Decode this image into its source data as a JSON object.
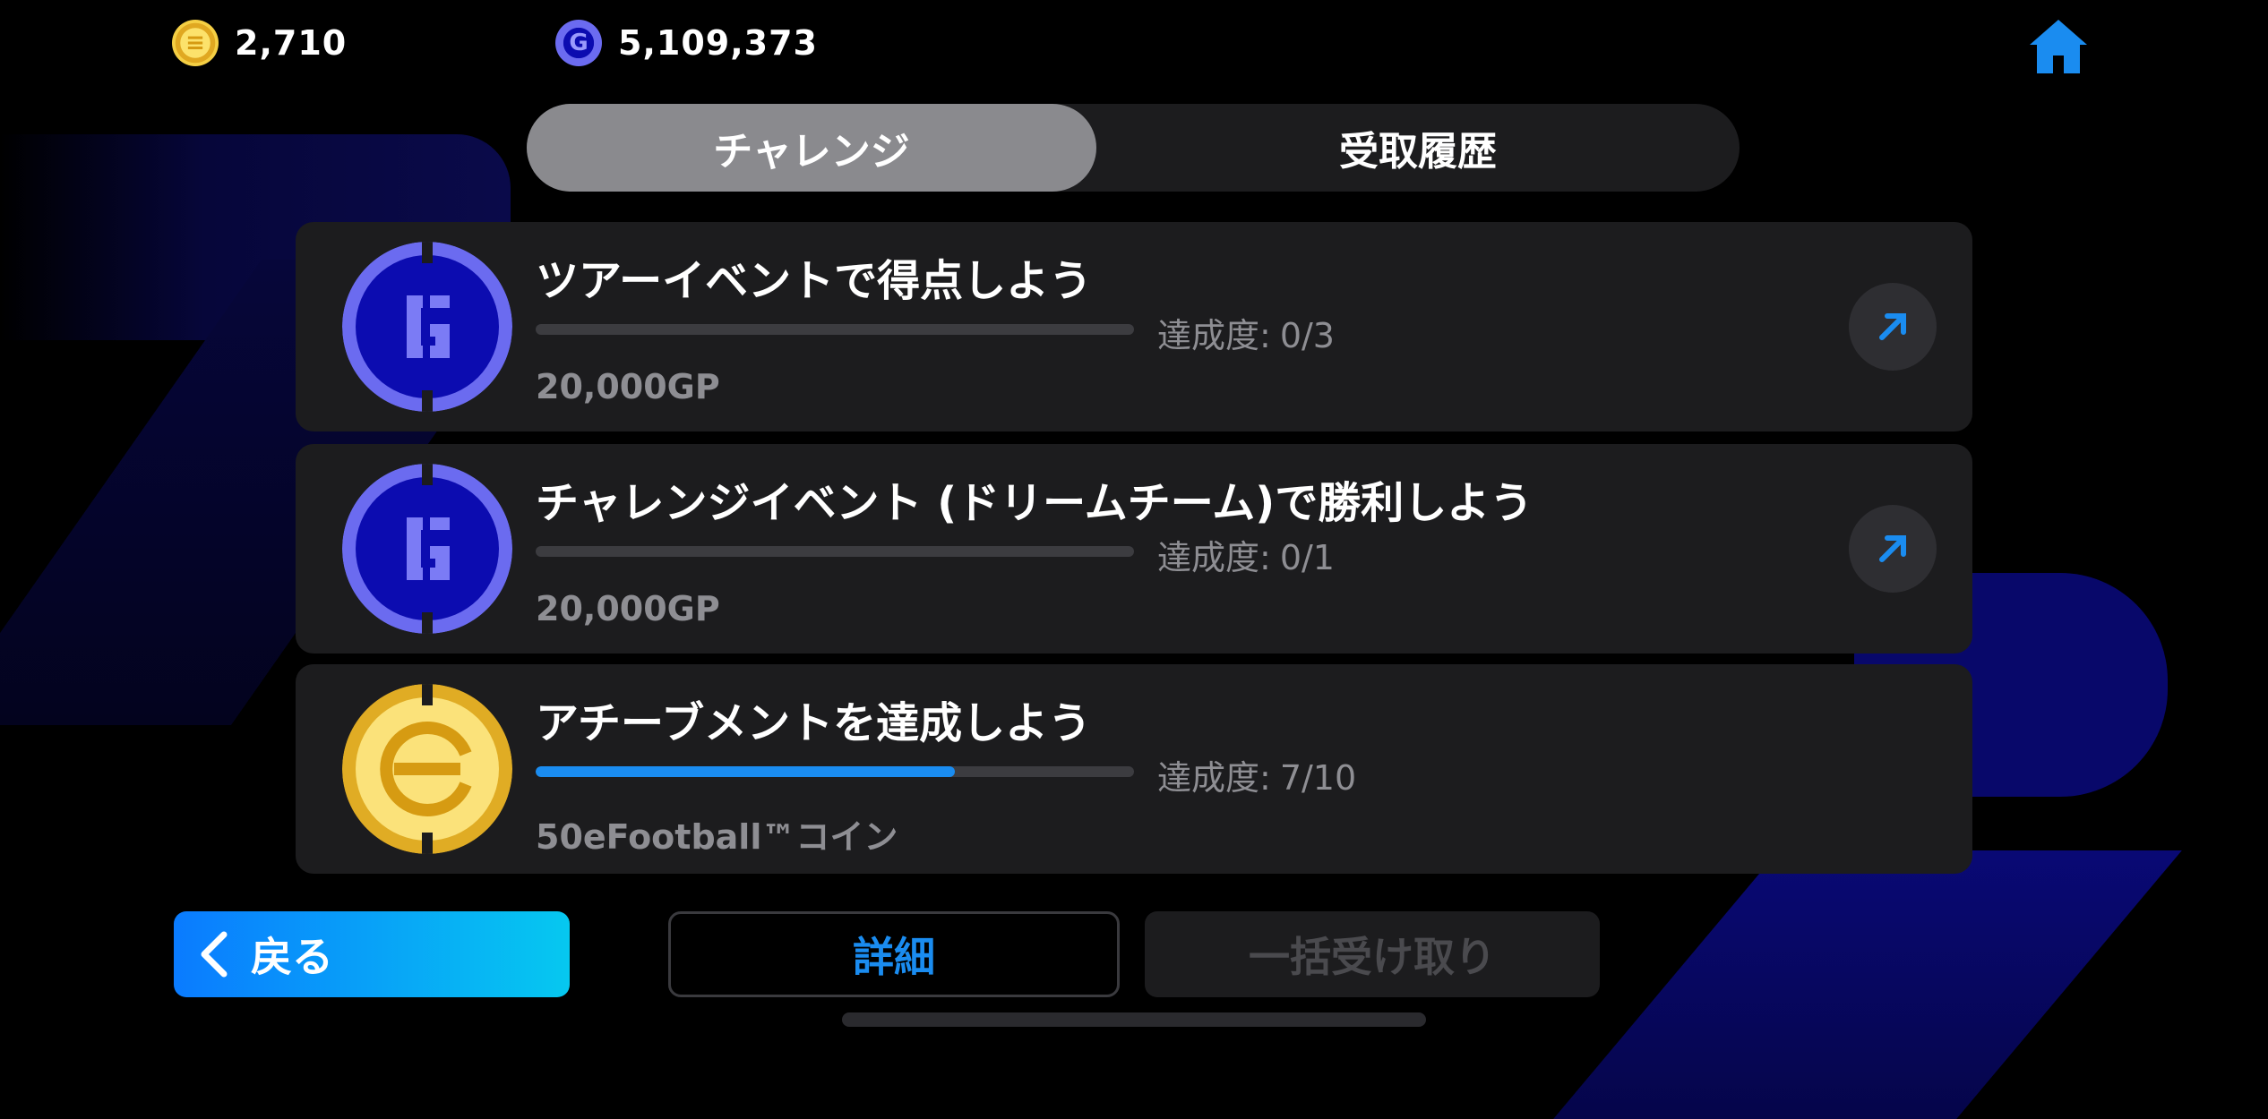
{
  "topbar": {
    "coins": {
      "icon": "efootball-coin-icon",
      "value": "2,710"
    },
    "gp": {
      "icon": "gp-coin-icon",
      "value": "5,109,373"
    },
    "home_icon": "home-icon"
  },
  "tabs": [
    {
      "label": "チャレンジ",
      "active": true
    },
    {
      "label": "受取履歴",
      "active": false
    }
  ],
  "challenges": [
    {
      "icon": "gp-coin-icon",
      "title": "ツアーイベントで得点しよう",
      "progress_label": "達成度:",
      "progress_value": "0/3",
      "progress_fraction": 0.0,
      "reward": "20,000GP"
    },
    {
      "icon": "gp-coin-icon",
      "title": "チャレンジイベント (ドリームチーム)で勝利しよう",
      "progress_label": "達成度:",
      "progress_value": "0/1",
      "progress_fraction": 0.0,
      "reward": "20,000GP"
    },
    {
      "icon": "efootball-coin-icon",
      "title": "アチーブメントを達成しよう",
      "progress_label": "達成度:",
      "progress_value": "7/10",
      "progress_fraction": 0.7,
      "reward": "50eFootball™コイン"
    }
  ],
  "footer": {
    "back_label": "戻る",
    "detail_label": "詳細",
    "claim_all_label": "一括受け取り"
  },
  "colors": {
    "accent": "#1a8cf0",
    "card": "#1c1c1e",
    "gp_blue": "#0c0cb0",
    "gold": "#e8b92a"
  }
}
